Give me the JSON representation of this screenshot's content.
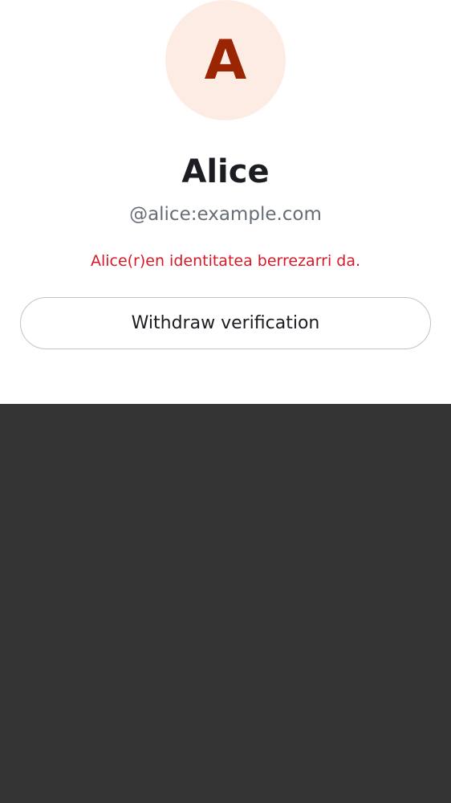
{
  "profile": {
    "avatar_initial": "A",
    "display_name": "Alice",
    "user_id": "@alice:example.com",
    "warning_text": "Alice(r)en identitatea berrezarri da."
  },
  "actions": {
    "withdraw_label": "Withdraw verification"
  },
  "colors": {
    "avatar_background": "#fdece4",
    "avatar_letter": "#9b2402",
    "warning": "#d51928",
    "backdrop": "#333333"
  }
}
